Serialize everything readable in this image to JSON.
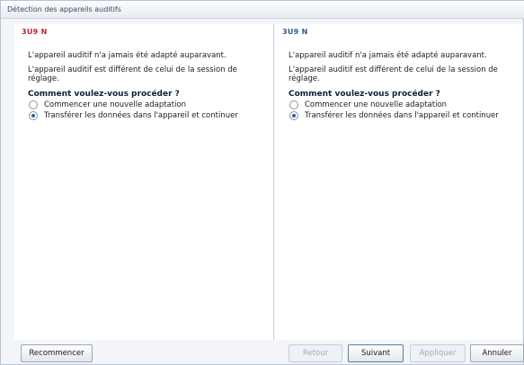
{
  "window": {
    "title": "Détection des appareils auditifs"
  },
  "left": {
    "device": "3U9 N",
    "device_color": "#c0202b",
    "msg1": "L'appareil auditif n'a jamais été adapté auparavant.",
    "msg2": "L'appareil auditif est différent de celui de la session de réglage.",
    "question": "Comment voulez-vous procéder ?",
    "options": [
      {
        "label": "Commencer une nouvelle adaptation",
        "selected": false
      },
      {
        "label": "Transférer les données dans l'appareil et continuer",
        "selected": true
      }
    ]
  },
  "right": {
    "device": "3U9 N",
    "device_color": "#2b5a9c",
    "msg1": "L'appareil auditif n'a jamais été adapté auparavant.",
    "msg2": "L'appareil auditif est différent de celui de la session de réglage.",
    "question": "Comment voulez-vous procéder ?",
    "options": [
      {
        "label": "Commencer une nouvelle adaptation",
        "selected": false
      },
      {
        "label": "Transférer les données dans l'appareil et continuer",
        "selected": true
      }
    ]
  },
  "footer": {
    "restart": "Recommencer",
    "back": "Retour",
    "next": "Suivant",
    "apply": "Appliquer",
    "cancel": "Annuler"
  }
}
